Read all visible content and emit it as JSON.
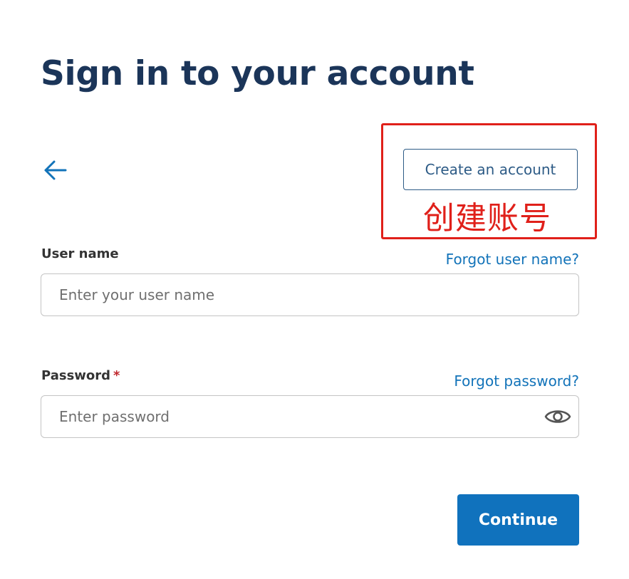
{
  "header": {
    "title": "Sign in to your account"
  },
  "nav": {
    "back_icon": "arrow-left-icon",
    "create_account_label": "Create an account"
  },
  "annotation": {
    "label": "创建账号",
    "color": "#e0201a"
  },
  "username": {
    "label": "User name",
    "forgot_label": "Forgot user name?",
    "placeholder": "Enter your user name",
    "value": ""
  },
  "password": {
    "label": "Password",
    "required_mark": "*",
    "forgot_label": "Forgot password?",
    "placeholder": "Enter password",
    "value": "",
    "toggle_icon": "eye-icon"
  },
  "actions": {
    "continue_label": "Continue"
  },
  "colors": {
    "title": "#1b3559",
    "link": "#1273b9",
    "primary_button": "#1072bd",
    "outline_button": "#2d5b86",
    "required": "#c0272d"
  }
}
